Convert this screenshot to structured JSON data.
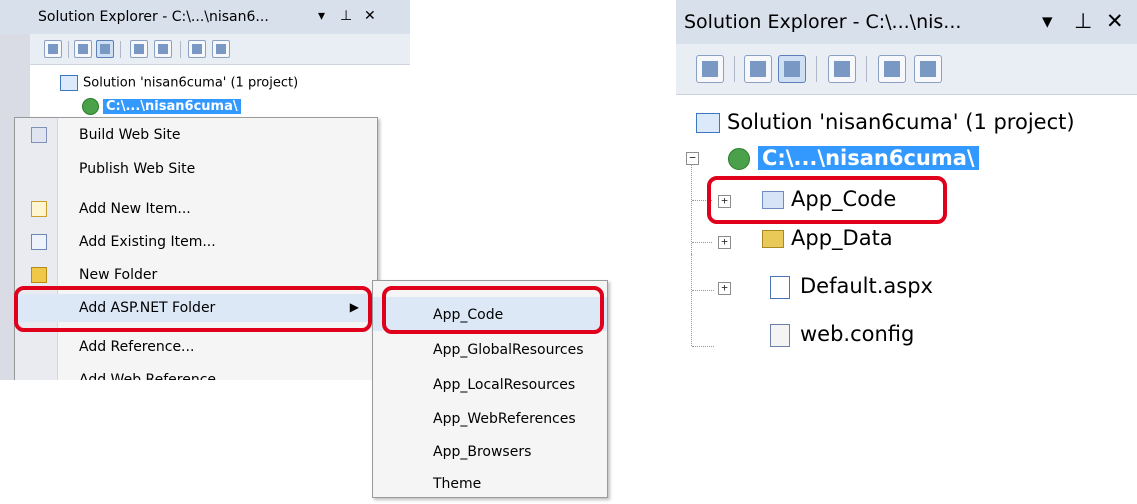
{
  "left": {
    "title": "Solution Explorer - C:\\...\\nisan6...",
    "pin_icon": "pin-icon",
    "close_glyph": "✕",
    "dropdown_glyph": "▾",
    "pin_glyph": "⊥",
    "solution_label": "Solution 'nisan6cuma' (1 project)",
    "project_label": "C:\\...\\nisan6cuma\\",
    "context_menu": [
      {
        "label": "Build Web Site",
        "icon": "build-icon"
      },
      {
        "label": "Publish Web Site",
        "icon": ""
      },
      {
        "label": "Add New Item...",
        "icon": "new-item-icon"
      },
      {
        "label": "Add Existing Item...",
        "icon": "existing-item-icon"
      },
      {
        "label": "New Folder",
        "icon": "folder-icon"
      },
      {
        "label": "Add ASP.NET Folder",
        "icon": "",
        "submenu_arrow": "▶"
      },
      {
        "label": "Add Reference...",
        "icon": ""
      },
      {
        "label": "Add Web Reference",
        "icon": ""
      }
    ],
    "submenu": [
      "App_Code",
      "App_GlobalResources",
      "App_LocalResources",
      "App_WebReferences",
      "App_Browsers",
      "Theme"
    ]
  },
  "right": {
    "title": "Solution Explorer - C:\\...\\nis...",
    "dropdown_glyph": "▾",
    "pin_glyph": "⊥",
    "close_glyph": "✕",
    "solution_label": "Solution 'nisan6cuma' (1 project)",
    "project_label": "C:\\...\\nisan6cuma\\",
    "items": [
      {
        "label": "App_Code",
        "icon": "app-code-folder-icon",
        "expander": "+"
      },
      {
        "label": "App_Data",
        "icon": "app-data-folder-icon",
        "expander": "+"
      },
      {
        "label": "Default.aspx",
        "icon": "aspx-page-icon",
        "expander": "+"
      },
      {
        "label": "web.config",
        "icon": "config-file-icon",
        "expander": ""
      }
    ],
    "collapse_glyph": "−"
  },
  "colors": {
    "highlight_red": "#e0001b",
    "selection_blue": "#3399ff",
    "titlebar": "#d8e0ec"
  }
}
